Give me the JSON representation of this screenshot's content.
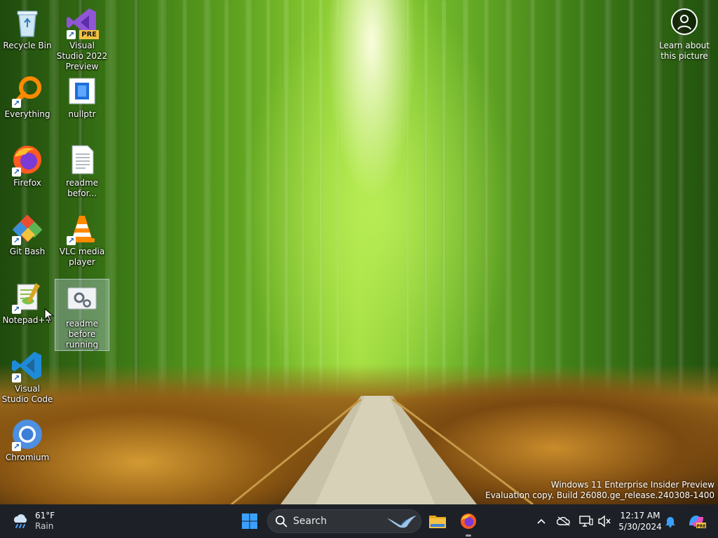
{
  "desktop": {
    "icons": [
      {
        "label": "Recycle Bin",
        "icon": "recycle-bin-icon"
      },
      {
        "label": "Visual Studio 2022 Preview",
        "icon": "visual-studio-icon",
        "badge": "PRE"
      },
      {
        "label": "Everything",
        "icon": "everything-search-icon"
      },
      {
        "label": "nullptr",
        "icon": "document-icon"
      },
      {
        "label": "Firefox",
        "icon": "firefox-icon"
      },
      {
        "label": "readme befor...",
        "icon": "text-file-icon"
      },
      {
        "label": "Git Bash",
        "icon": "git-bash-icon"
      },
      {
        "label": "VLC media player",
        "icon": "vlc-icon"
      },
      {
        "label": "Notepad++",
        "icon": "notepad-plus-plus-icon"
      },
      {
        "label": "readme before running",
        "icon": "settings-gear-icon"
      },
      {
        "label": "Visual Studio Code",
        "icon": "vscode-icon"
      },
      {
        "label": "Chromium",
        "icon": "chromium-icon"
      }
    ],
    "learn_about_picture": "Learn about this picture",
    "watermark": {
      "line1": "Windows 11 Enterprise Insider Preview",
      "line2": "Evaluation copy. Build 26080.ge_release.240308-1400"
    }
  },
  "taskbar": {
    "weather": {
      "temp": "61°F",
      "condition": "Rain",
      "icon": "rain-cloud-icon"
    },
    "search_label": "Search",
    "pinned": [
      {
        "name": "start-button",
        "icon": "windows-logo-icon"
      },
      {
        "name": "file-explorer",
        "icon": "folder-icon"
      },
      {
        "name": "firefox",
        "icon": "firefox-icon"
      }
    ],
    "clock": {
      "time": "12:17 AM",
      "date": "5/30/2024"
    }
  },
  "colors": {
    "taskbar_bg": "#1d2127",
    "windows_blue": "#3aa0ff",
    "folder_yellow": "#f5c242"
  }
}
